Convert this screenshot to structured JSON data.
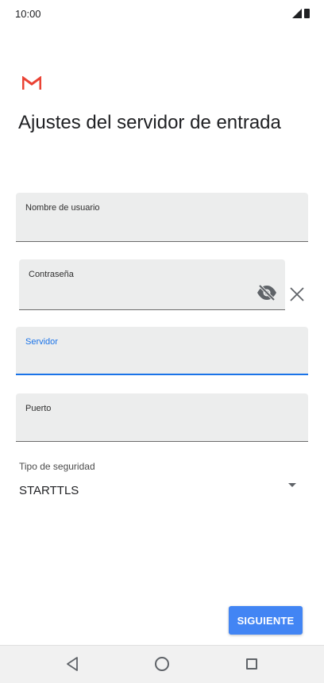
{
  "status_bar": {
    "time": "10:00",
    "icons": [
      "signal-icon",
      "battery-icon"
    ]
  },
  "app": {
    "logo": "gmail-logo",
    "title": "Ajustes del servidor de entrada"
  },
  "form": {
    "username": {
      "label": "Nombre de usuario",
      "value": ""
    },
    "password": {
      "label": "Contraseña",
      "value": "",
      "toggle_icon": "visibility-off-icon"
    },
    "clear_icon": "close-icon",
    "server": {
      "label": "Servidor",
      "value": "",
      "focused": true
    },
    "port": {
      "label": "Puerto",
      "value": ""
    },
    "security": {
      "label": "Tipo de seguridad",
      "value": "STARTTLS"
    }
  },
  "actions": {
    "next_label": "SIGUIENTE"
  },
  "nav_bar": {
    "icons": [
      "back-icon",
      "home-icon",
      "recents-icon"
    ]
  },
  "colors": {
    "accent": "#1a73e8",
    "button": "#4285f4",
    "field_bg": "#eceded",
    "gmail_red": "#ea4335"
  }
}
